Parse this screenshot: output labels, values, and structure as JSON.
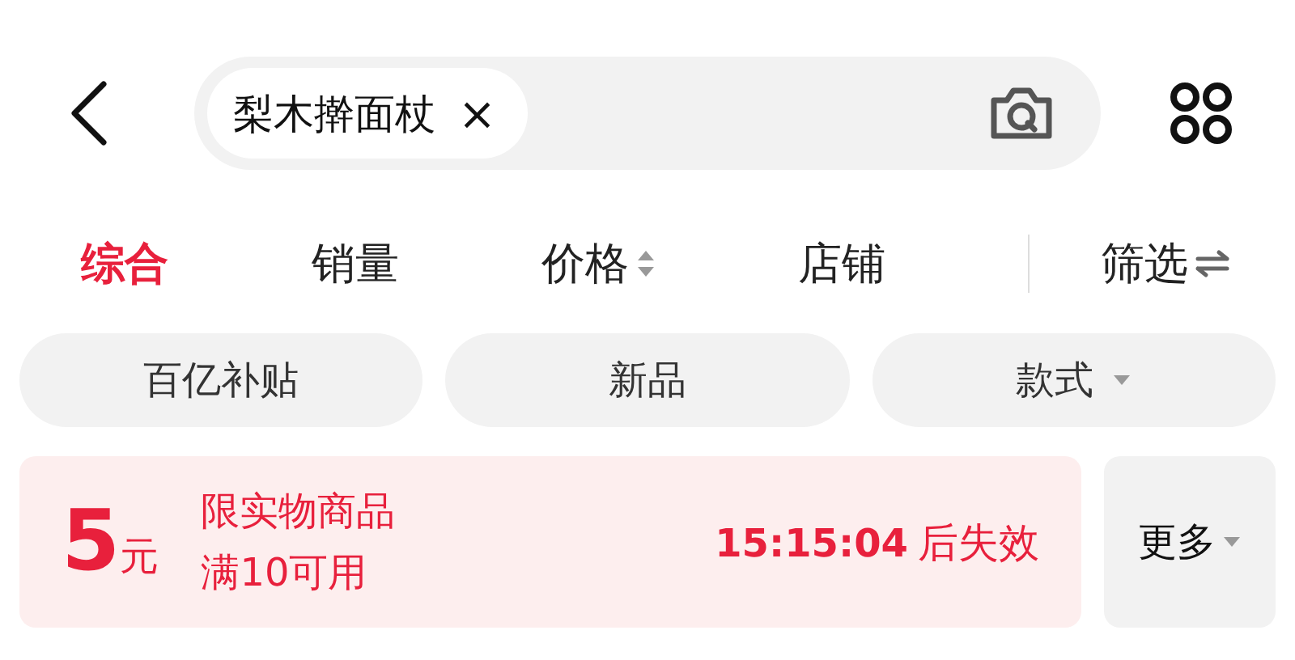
{
  "search": {
    "query": "梨木擀面杖",
    "clear": "×"
  },
  "sort_tabs": [
    {
      "label": "综合",
      "selected": true,
      "kind": "plain"
    },
    {
      "label": "销量",
      "selected": false,
      "kind": "plain"
    },
    {
      "label": "价格",
      "selected": false,
      "kind": "sortable"
    },
    {
      "label": "店铺",
      "selected": false,
      "kind": "plain"
    },
    {
      "label": "筛选",
      "selected": false,
      "kind": "filter"
    }
  ],
  "chips": [
    {
      "label": "百亿补贴",
      "dropdown": false
    },
    {
      "label": "新品",
      "dropdown": false
    },
    {
      "label": "款式",
      "dropdown": true
    }
  ],
  "coupon": {
    "amount": "5",
    "unit": "元",
    "lines": [
      "限实物商品",
      "满10可用"
    ],
    "timer": "15:15:04",
    "expiry_text": "后失效"
  },
  "more": {
    "label": "更多"
  }
}
